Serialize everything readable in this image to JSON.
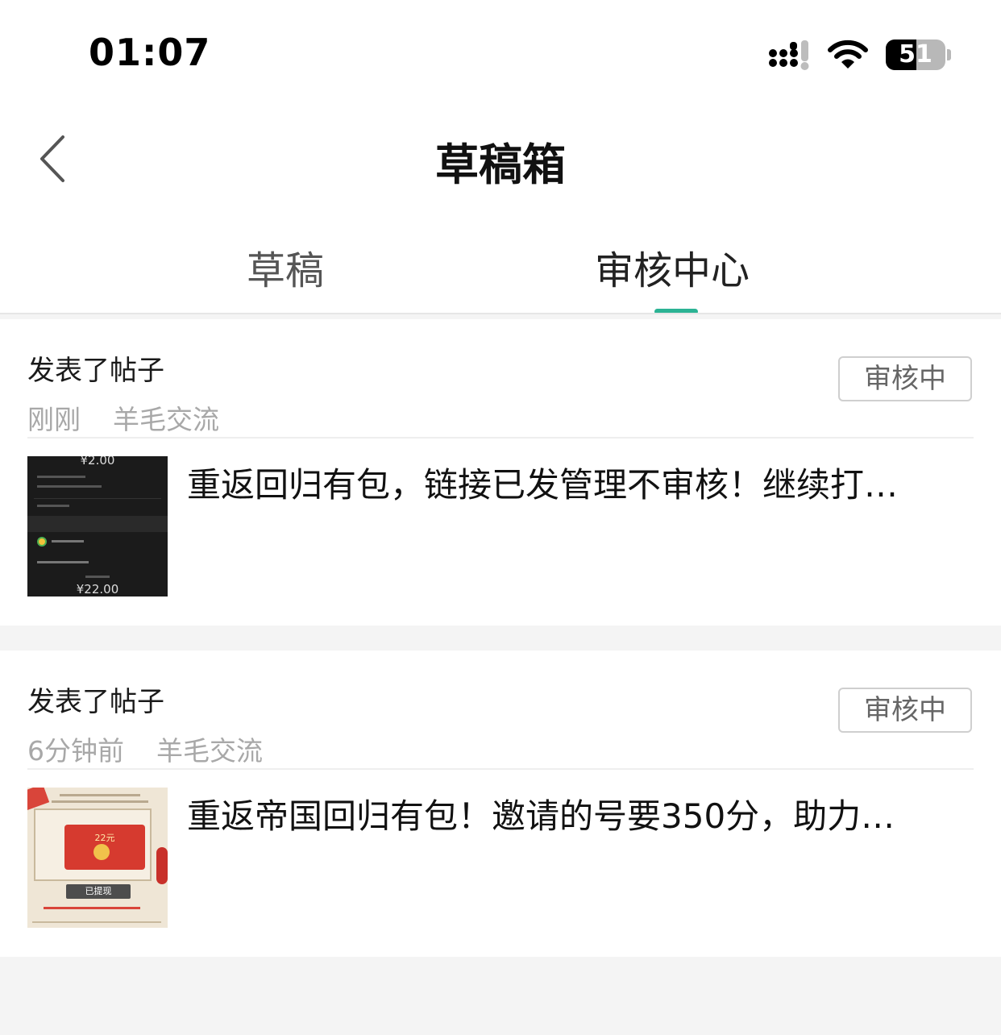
{
  "status_bar": {
    "time": "01:07",
    "battery": "51",
    "battery_level": 0.51
  },
  "header": {
    "title": "草稿箱"
  },
  "tabs": [
    {
      "label": "草稿",
      "active": false
    },
    {
      "label": "审核中心",
      "active": true
    }
  ],
  "colors": {
    "accent": "#2bb394"
  },
  "posts": [
    {
      "action": "发表了帖子",
      "time": "刚刚",
      "category": "羊毛交流",
      "status": "审核中",
      "title": "重返回归有包，链接已发管理不审核！继续打…",
      "thumb": {
        "amount_top": "¥2.00",
        "amount_bottom": "¥22.00"
      }
    },
    {
      "action": "发表了帖子",
      "time": "6分钟前",
      "category": "羊毛交流",
      "status": "审核中",
      "title": "重返帝国回归有包！邀请的号要350分，助力…",
      "thumb": {
        "amount": "22元",
        "button": "已提现"
      }
    }
  ]
}
